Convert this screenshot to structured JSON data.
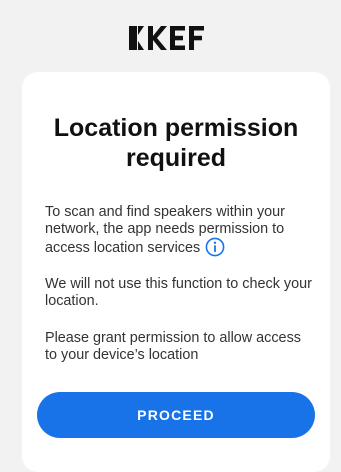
{
  "brand": {
    "logo_text": "KEF",
    "logo_icon": "kef-logo"
  },
  "dialog": {
    "title": "Location permission required",
    "paragraph1": "To scan and find speakers within your network, the app needs permission to access location services",
    "info_icon": "info-icon",
    "paragraph2": "We will not use this function to check your location.",
    "paragraph3": "Please grant permission to allow access to your device’s location"
  },
  "actions": {
    "proceed_label": "PROCEED"
  },
  "colors": {
    "background": "#f2f2f2",
    "card": "#ffffff",
    "accent": "#1873e8",
    "text": "#333333"
  }
}
